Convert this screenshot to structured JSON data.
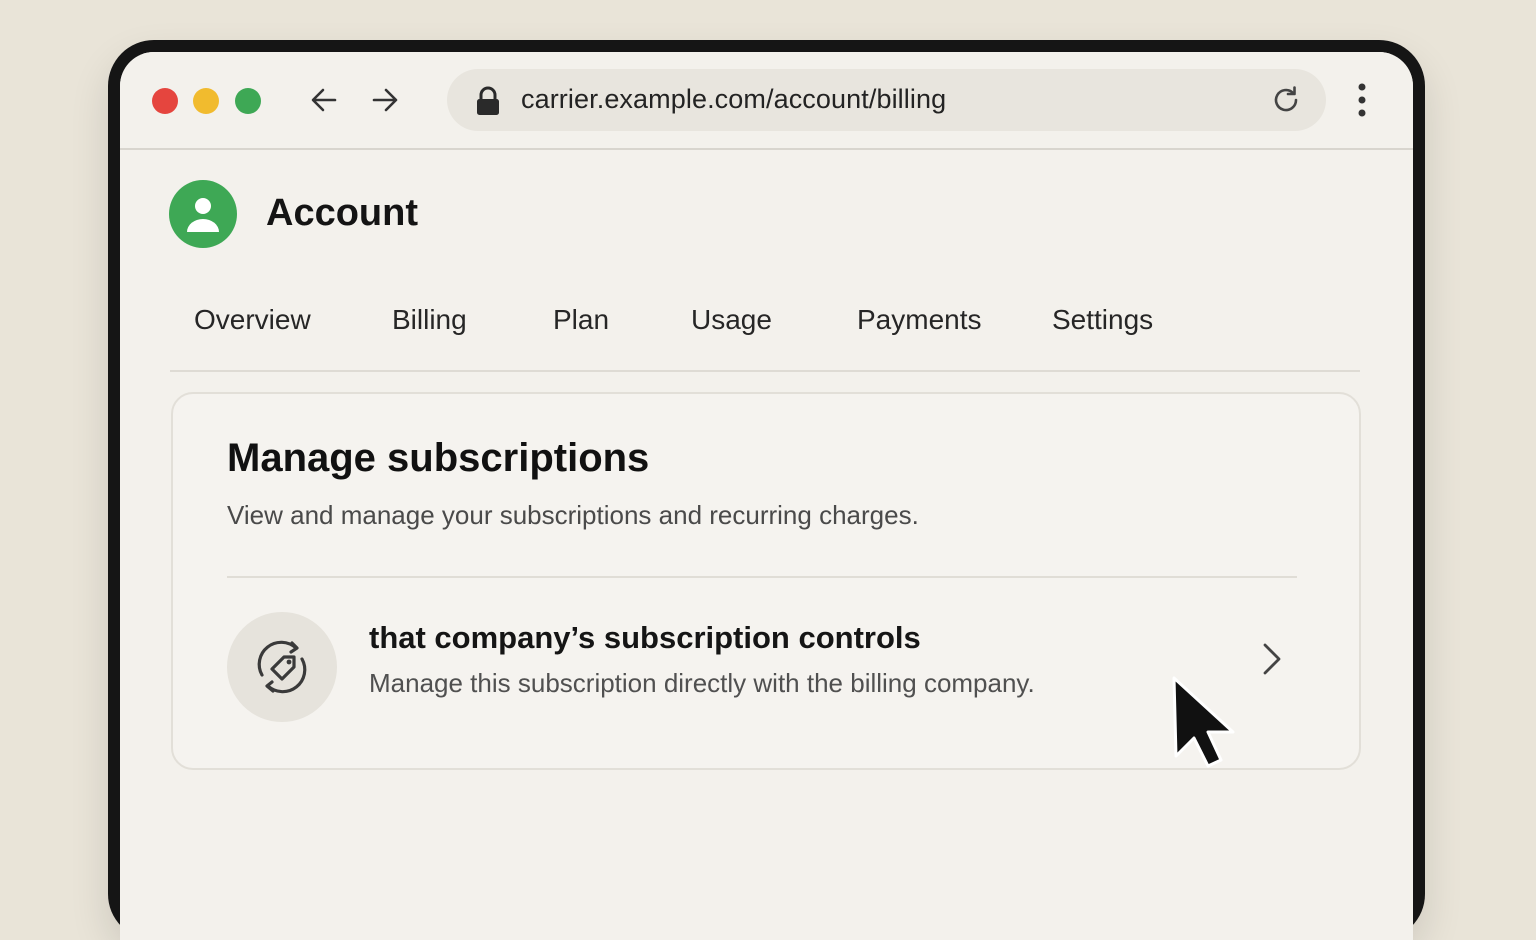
{
  "browser": {
    "url": "carrier.example.com/account/billing"
  },
  "header": {
    "title": "Account"
  },
  "tabs": [
    {
      "label": "Overview"
    },
    {
      "label": "Billing"
    },
    {
      "label": "Plan"
    },
    {
      "label": "Usage"
    },
    {
      "label": "Payments"
    },
    {
      "label": "Settings"
    }
  ],
  "card": {
    "title": "Manage subscriptions",
    "subtitle": "View and manage your subscriptions and recurring charges.",
    "item": {
      "title": "that company’s subscription controls",
      "description": "Manage this subscription directly with the billing company.",
      "icon": "subscription-sync-icon"
    }
  },
  "colors": {
    "accent_green": "#3ea855",
    "traffic_red": "#e5453e",
    "traffic_yellow": "#f1bb2e",
    "traffic_green": "#3ea855"
  }
}
